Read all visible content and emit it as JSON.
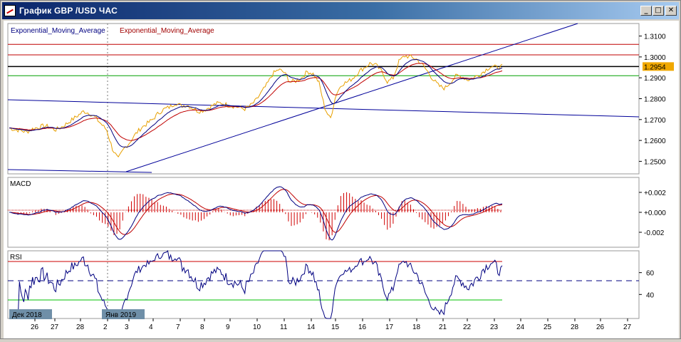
{
  "window": {
    "title": "График GBP /USD  ЧАС",
    "minimize_glyph": "_",
    "maximize_glyph": "□",
    "close_glyph": "✕"
  },
  "legend": {
    "ema1": "Exponential_Moving_Average",
    "ema2": "Exponential_Moving_Average",
    "ema1_color": "#000080",
    "ema2_color": "#a00000"
  },
  "price_axis": {
    "ticks": [
      "1.3100",
      "1.3000",
      "1.2900",
      "1.2800",
      "1.2700",
      "1.2600",
      "1.2500"
    ],
    "current_price": "1.2954",
    "current_price_bg": "#f0a800"
  },
  "macd": {
    "label": "MACD",
    "ticks": [
      "+0.002",
      "+0.000",
      "-0.002"
    ]
  },
  "rsi": {
    "label": "RSI",
    "ticks": [
      "60",
      "40"
    ]
  },
  "date_badges": [
    "Дек 2018",
    "Янв 2019"
  ],
  "x_labels": [
    "26",
    "27",
    "28",
    "2",
    "3",
    "4",
    "7",
    "8",
    "9",
    "10",
    "11",
    "14",
    "15",
    "16",
    "17",
    "18",
    "21",
    "22",
    "23",
    "24",
    "25",
    "28",
    "26",
    "27",
    "28"
  ],
  "colors": {
    "price_line": "#e8a000",
    "ema_fast": "#000080",
    "ema_slow": "#c00000",
    "red_hline": "#c00000",
    "green_hline": "#00a000",
    "black_hline": "#000000",
    "trendline": "#000099",
    "macd_hist": "#d00000",
    "rsi_line": "#000080",
    "rsi_upper": "#cc0000",
    "rsi_lower": "#00c000",
    "rsi_overbought": "#e000e0"
  },
  "chart_data": {
    "type": "line",
    "panes": [
      "price",
      "MACD",
      "RSI"
    ],
    "price_series": [
      1.266,
      1.2652,
      1.2648,
      1.264,
      1.2655,
      1.2662,
      1.267,
      1.2665,
      1.265,
      1.2662,
      1.268,
      1.27,
      1.272,
      1.274,
      1.273,
      1.271,
      1.268,
      1.265,
      1.256,
      1.251,
      1.256,
      1.259,
      1.263,
      1.266,
      1.268,
      1.27,
      1.273,
      1.275,
      1.276,
      1.278,
      1.2765,
      1.277,
      1.2755,
      1.274,
      1.2745,
      1.276,
      1.2775,
      1.278,
      1.277,
      1.2765,
      1.276,
      1.275,
      1.2765,
      1.279,
      1.283,
      1.287,
      1.292,
      1.294,
      1.2925,
      1.288,
      1.2885,
      1.29,
      1.293,
      1.292,
      1.288,
      1.276,
      1.27,
      1.282,
      1.287,
      1.288,
      1.29,
      1.293,
      1.295,
      1.297,
      1.296,
      1.293,
      1.288,
      1.29,
      1.298,
      1.3005,
      1.3,
      1.299,
      1.2965,
      1.293,
      1.289,
      1.286,
      1.285,
      1.288,
      1.291,
      1.2905,
      1.289,
      1.29,
      1.2915,
      1.2935,
      1.2955,
      1.295,
      1.2954
    ],
    "ylim": [
      1.244,
      1.316
    ],
    "hlines": {
      "red": [
        1.306,
        1.301
      ],
      "black": 1.2954,
      "green": 1.291
    },
    "macd_ylim": [
      -0.0035,
      0.0035
    ],
    "rsi_ylim": [
      18,
      80
    ],
    "rsi_levels": [
      70,
      30,
      50
    ]
  }
}
